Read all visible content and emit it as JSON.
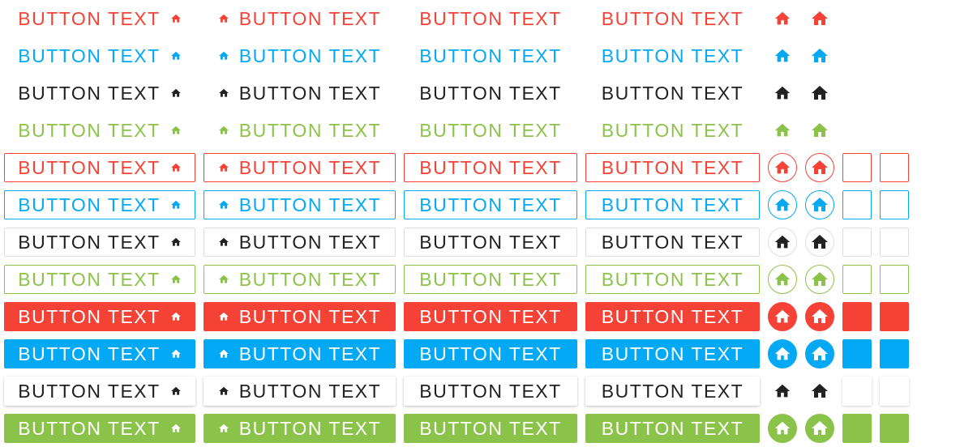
{
  "button_label": "BUTTON TEXT",
  "icon": "home-icon",
  "colors": {
    "red": "#f44336",
    "blue": "#03a9f4",
    "black": "#212121",
    "green": "#8bc34a",
    "white": "#ffffff",
    "neutral_border": "#dedede"
  },
  "groups": [
    "flat",
    "outlined",
    "raised"
  ],
  "color_order": [
    "red",
    "blue",
    "black",
    "green"
  ],
  "columns": [
    "text-with-trailing-icon",
    "text-with-leading-icon",
    "text-only",
    "text-only-wide",
    "icon-only-small",
    "icon-only-large",
    "square-blank-narrow",
    "square-blank"
  ]
}
